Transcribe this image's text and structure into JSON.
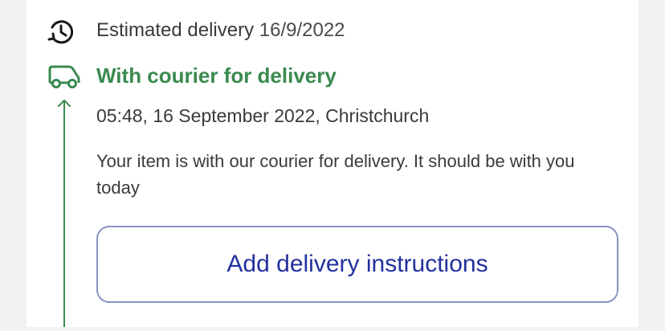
{
  "eta": {
    "label": "Estimated delivery",
    "date": "16/9/2022",
    "icon": "clock-icon"
  },
  "status": {
    "title": "With courier for delivery",
    "timestamp_location": "05:48, 16 September 2022, Christchurch",
    "description": "Your item is with our courier for delivery. It should be with you today",
    "icon": "delivery-van-icon",
    "color": "#3a8a4f"
  },
  "actions": {
    "add_instructions_label": "Add delivery instructions",
    "color": "#23309c"
  }
}
